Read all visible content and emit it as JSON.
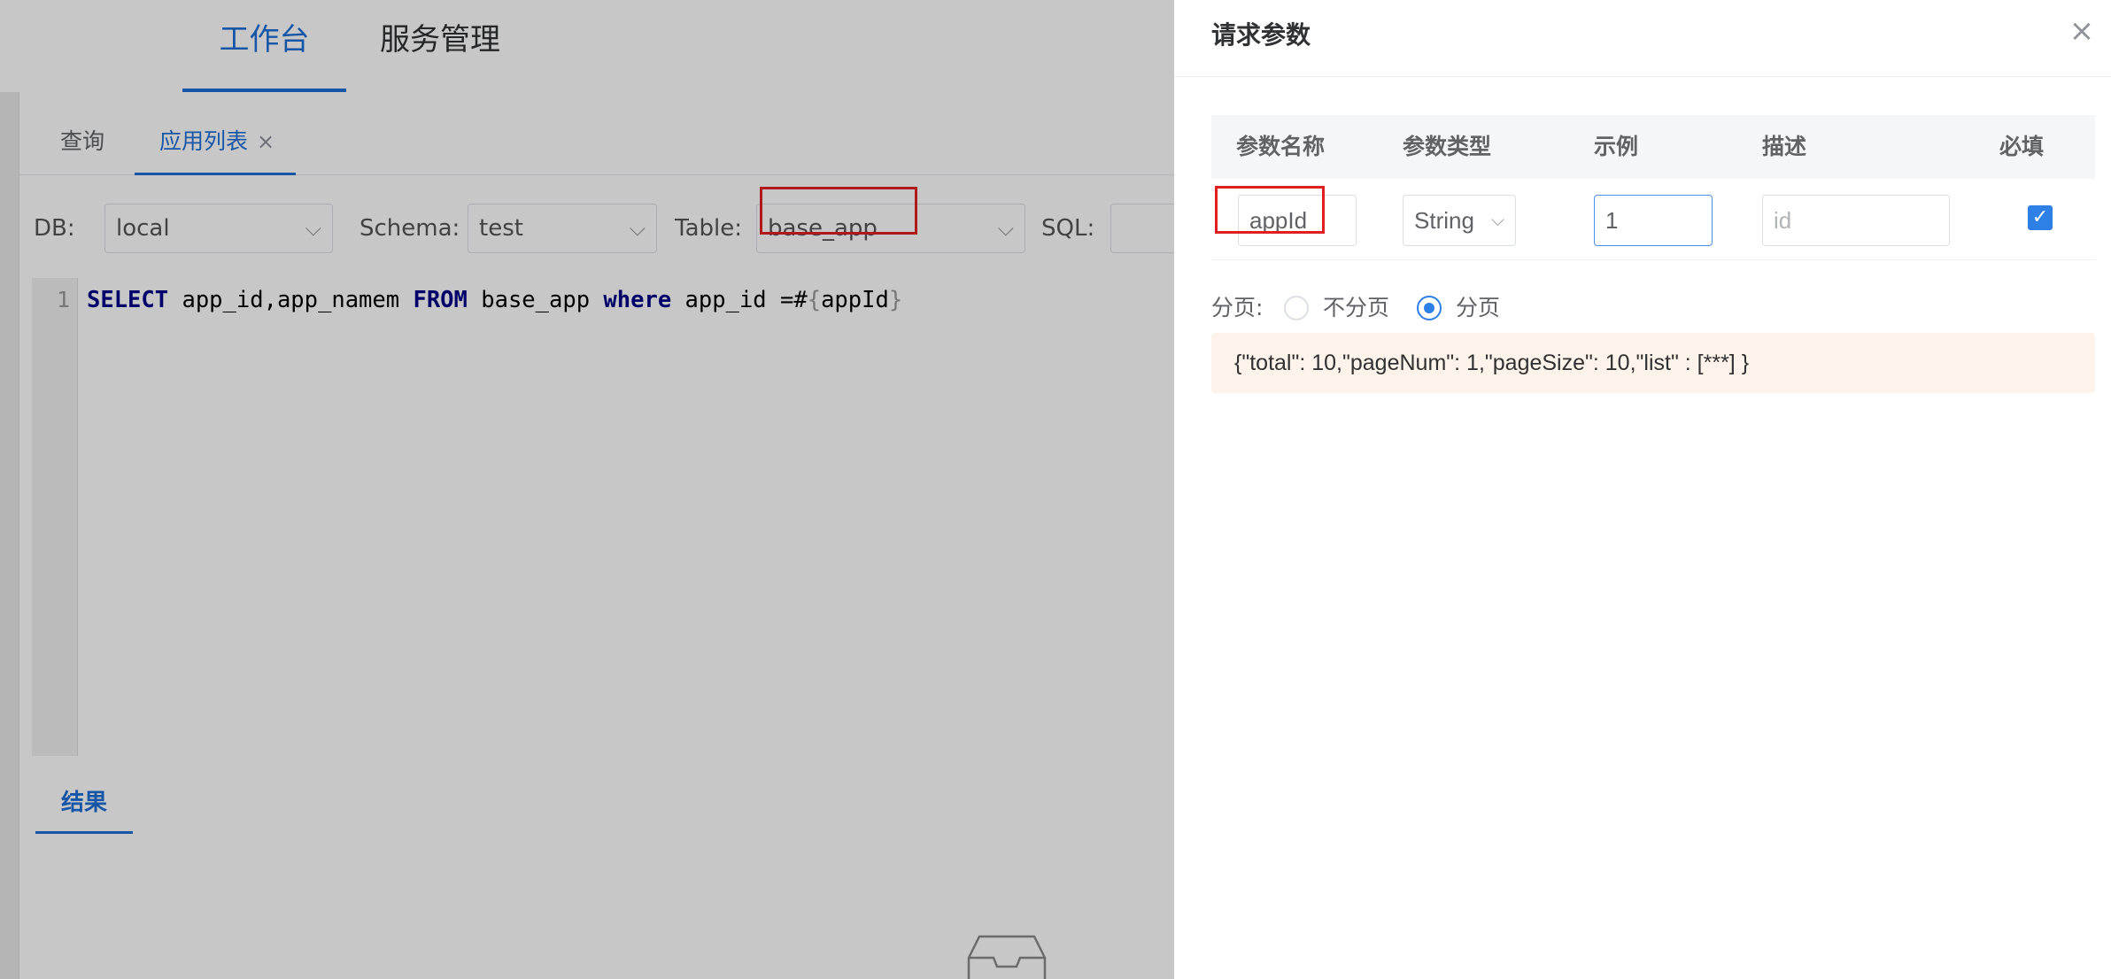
{
  "topnav": {
    "items": [
      "工作台",
      "服务管理"
    ],
    "active": "工作台"
  },
  "tabs": {
    "query": "查询",
    "applist": "应用列表",
    "close_glyph": "×"
  },
  "filters": {
    "db_label": "DB:",
    "db_value": "local",
    "schema_label": "Schema:",
    "schema_value": "test",
    "table_label": "Table:",
    "table_value": "base_app",
    "sql_label": "SQL:"
  },
  "editor": {
    "line_number": "1",
    "kw_select": "SELECT",
    "cols": " app_id,app_namem ",
    "kw_from": "FROM",
    "table": " base_app ",
    "kw_where": "where",
    "cond": " app_id =#",
    "brace_open": "{",
    "param": "appId",
    "brace_close": "}"
  },
  "result_tab": "结果",
  "drawer": {
    "title": "请求参数",
    "close_glyph": "×",
    "table_headers": [
      "参数名称",
      "参数类型",
      "示例",
      "描述",
      "必填"
    ],
    "row": {
      "name": "appId",
      "type": "String",
      "example": "1",
      "description_placeholder": "id",
      "required": true
    },
    "paging": {
      "label": "分页:",
      "options": [
        "不分页",
        "分页"
      ],
      "selected": "分页"
    },
    "response_example": "{\"total\": 10,\"pageNum\": 1,\"pageSize\": 10,\"list\" : [***] }"
  },
  "colors": {
    "accent": "#1e6fd6",
    "highlight": "#e02020",
    "response_bg": "#fdf3ea"
  }
}
